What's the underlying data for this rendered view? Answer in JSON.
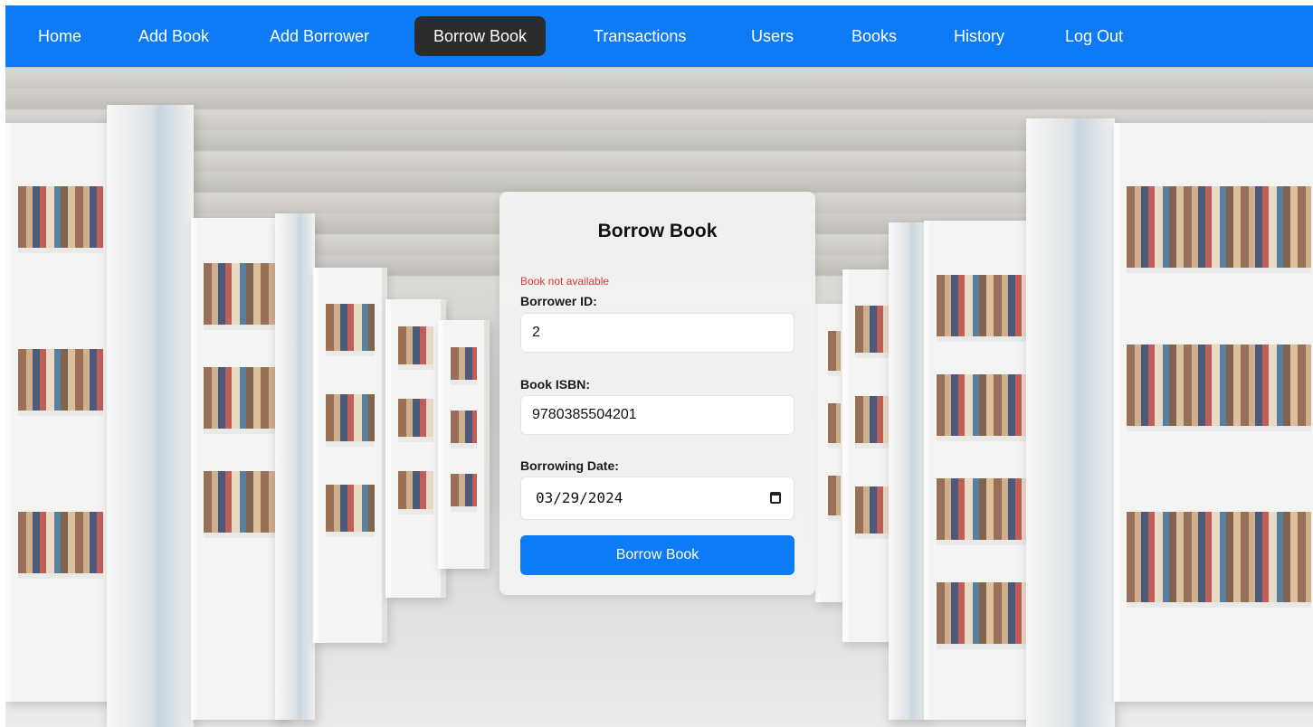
{
  "nav": {
    "items": [
      {
        "label": "Home"
      },
      {
        "label": "Add Book"
      },
      {
        "label": "Add Borrower"
      },
      {
        "label": "Borrow Book",
        "active": true
      },
      {
        "label": "Transactions"
      },
      {
        "label": "Users"
      },
      {
        "label": "Books"
      },
      {
        "label": "History"
      },
      {
        "label": "Log Out"
      }
    ]
  },
  "form": {
    "title": "Borrow Book",
    "error": "Book not available",
    "borrower_id_label": "Borrower ID:",
    "borrower_id_value": "2",
    "isbn_label": "Book ISBN:",
    "isbn_value": "9780385504201",
    "date_label": "Borrowing Date:",
    "date_value": "03/29/2024",
    "submit_label": "Borrow Book"
  },
  "colors": {
    "nav_background": "#0d7bf5",
    "nav_active": "#2c2c2c",
    "button": "#0d7bf5",
    "error": "#e0353b"
  },
  "icons": {
    "date_picker": "calendar-icon"
  }
}
